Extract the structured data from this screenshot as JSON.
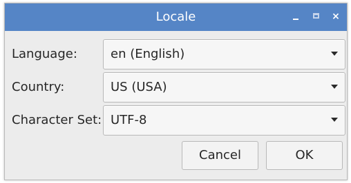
{
  "window": {
    "title": "Locale",
    "controls": {
      "minimize": "minimize-icon",
      "maximize": "maximize-icon",
      "close": "×"
    }
  },
  "form": {
    "language": {
      "label": "Language:",
      "value": "en (English)"
    },
    "country": {
      "label": "Country:",
      "value": "US (USA)"
    },
    "charset": {
      "label": "Character Set:",
      "value": "UTF-8"
    }
  },
  "buttons": {
    "cancel": "Cancel",
    "ok": "OK"
  },
  "colors": {
    "titlebar": "#5585c6",
    "window_bg": "#ececec"
  }
}
